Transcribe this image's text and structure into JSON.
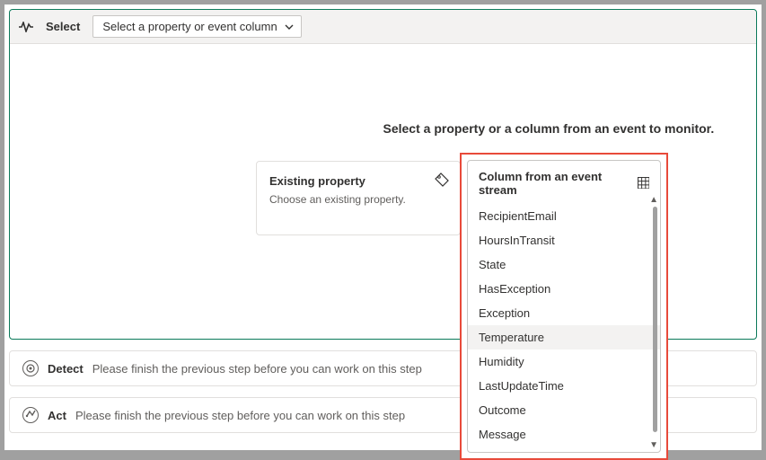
{
  "toolbar": {
    "select_label": "Select",
    "dropdown_value": "Select a property or event column"
  },
  "headline": "Select a property or a column from an event to monitor.",
  "existing_card": {
    "title": "Existing property",
    "subtitle": "Choose an existing property."
  },
  "column_popup": {
    "title": "Column from an event stream",
    "items": [
      "RecipientEmail",
      "HoursInTransit",
      "State",
      "HasException",
      "Exception",
      "Temperature",
      "Humidity",
      "LastUpdateTime",
      "Outcome",
      "Message"
    ],
    "hover_index": 5
  },
  "steps": {
    "detect": {
      "title": "Detect",
      "msg": "Please finish the previous step before you can work on this step"
    },
    "act": {
      "title": "Act",
      "msg": "Please finish the previous step before you can work on this step"
    }
  }
}
